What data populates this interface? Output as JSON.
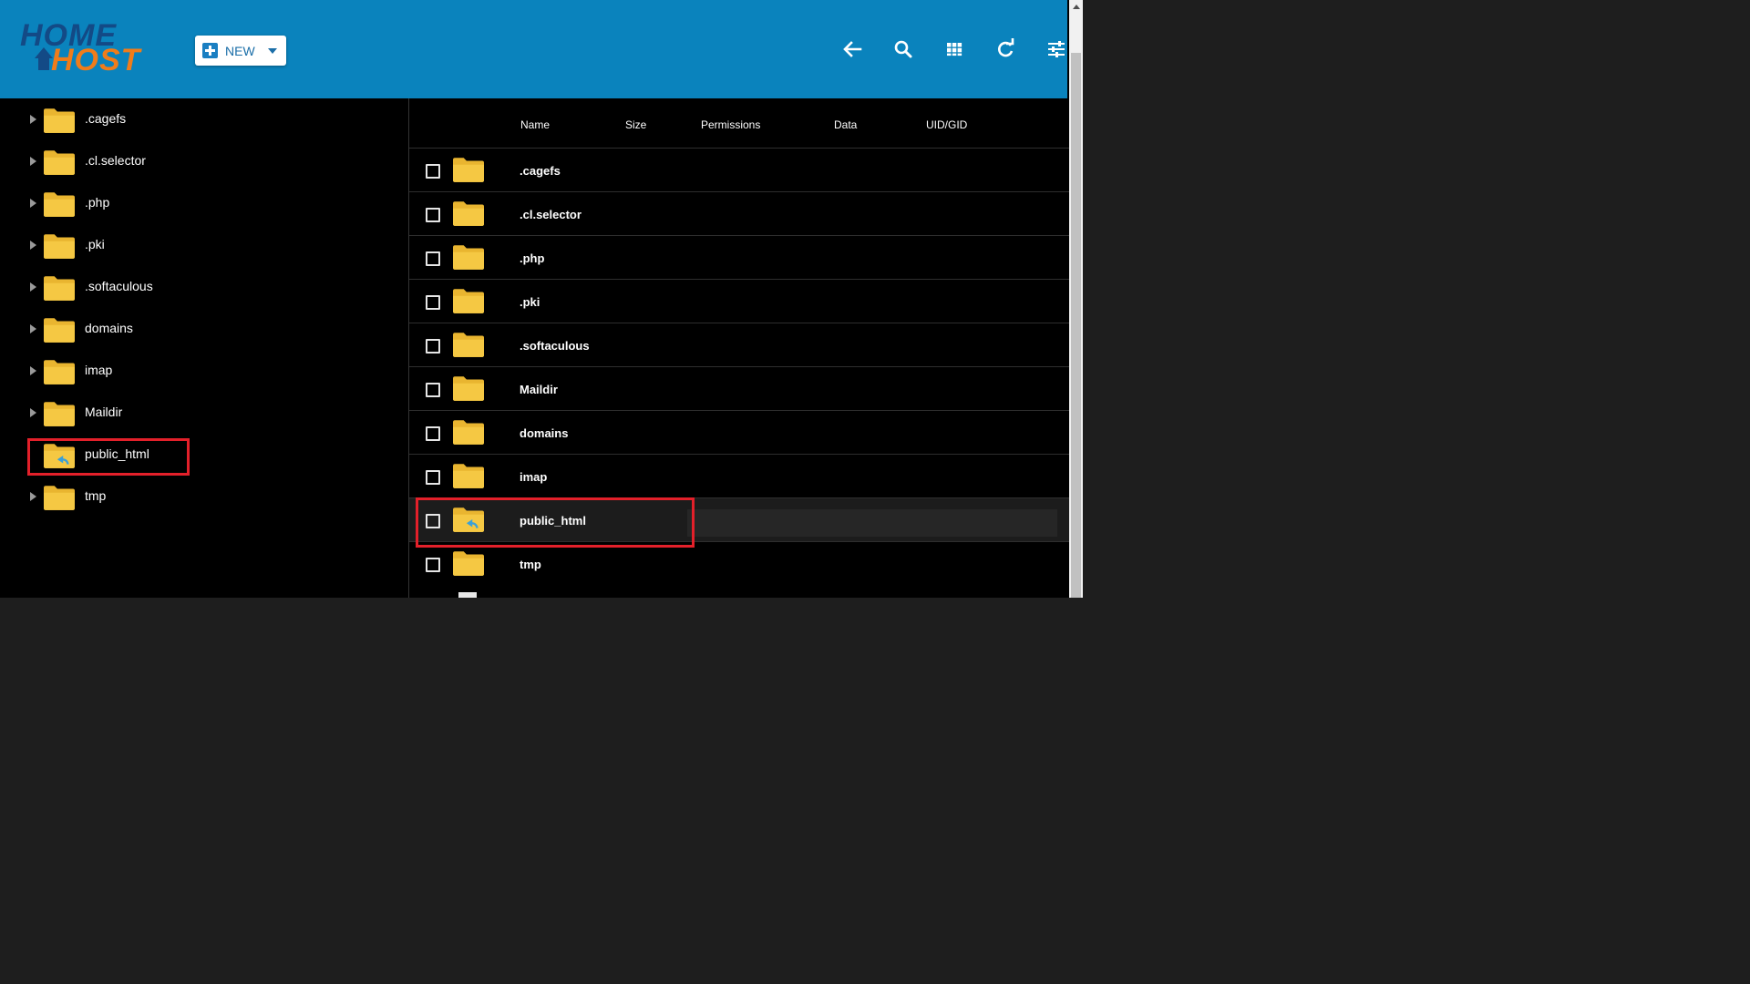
{
  "header": {
    "logo_line1": "HOME",
    "logo_line2": "HOST",
    "new_label": "NEW",
    "tools": [
      "back-arrow-icon",
      "search-icon",
      "grid-view-icon",
      "refresh-icon",
      "settings-sliders-icon"
    ]
  },
  "tree": {
    "items": [
      {
        "label": ".cagefs",
        "expandable": true,
        "shared": false
      },
      {
        "label": ".cl.selector",
        "expandable": true,
        "shared": false
      },
      {
        "label": ".php",
        "expandable": true,
        "shared": false
      },
      {
        "label": ".pki",
        "expandable": true,
        "shared": false
      },
      {
        "label": ".softaculous",
        "expandable": true,
        "shared": false
      },
      {
        "label": "domains",
        "expandable": true,
        "shared": false
      },
      {
        "label": "imap",
        "expandable": true,
        "shared": false
      },
      {
        "label": "Maildir",
        "expandable": true,
        "shared": false
      },
      {
        "label": "public_html",
        "expandable": false,
        "shared": true
      },
      {
        "label": "tmp",
        "expandable": true,
        "shared": false
      }
    ]
  },
  "table": {
    "columns": {
      "name": "Name",
      "size": "Size",
      "permissions": "Permissions",
      "data": "Data",
      "uid": "UID/GID"
    },
    "rows": [
      {
        "name": ".cagefs",
        "shared": false,
        "highlighted": false
      },
      {
        "name": ".cl.selector",
        "shared": false,
        "highlighted": false
      },
      {
        "name": ".php",
        "shared": false,
        "highlighted": false
      },
      {
        "name": ".pki",
        "shared": false,
        "highlighted": false
      },
      {
        "name": ".softaculous",
        "shared": false,
        "highlighted": false
      },
      {
        "name": "Maildir",
        "shared": false,
        "highlighted": false
      },
      {
        "name": "domains",
        "shared": false,
        "highlighted": false
      },
      {
        "name": "imap",
        "shared": false,
        "highlighted": false
      },
      {
        "name": "public_html",
        "shared": true,
        "highlighted": true
      },
      {
        "name": "tmp",
        "shared": false,
        "highlighted": false
      }
    ]
  },
  "colors": {
    "header_bg": "#0a83bd",
    "folder": "#f5c843",
    "folder_tab": "#e9b530",
    "shared_arrow": "#3aa0d8",
    "annotation": "#e3202a"
  }
}
